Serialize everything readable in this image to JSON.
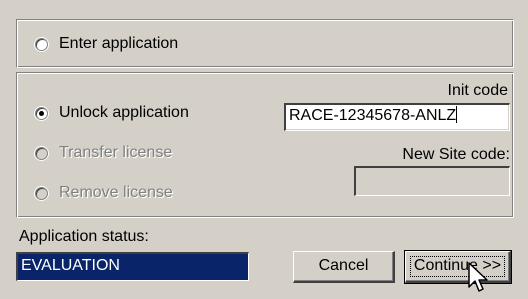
{
  "mode_options": {
    "enter": {
      "label": "Enter application",
      "selected": false
    },
    "unlock": {
      "label": "Unlock application",
      "selected": true
    },
    "transfer": {
      "label": "Transfer license",
      "selected": false,
      "enabled": false
    },
    "remove": {
      "label": "Remove license",
      "selected": false,
      "enabled": false
    }
  },
  "init_code": {
    "label": "Init code",
    "value": "RACE-12345678-ANLZ"
  },
  "new_site_code": {
    "label": "New Site code:",
    "value": ""
  },
  "status": {
    "label": "Application status:",
    "value": "EVALUATION"
  },
  "buttons": {
    "cancel": "Cancel",
    "continue": "Continue >>"
  },
  "icons": {
    "cursor": "arrow-pointer-icon"
  },
  "colors": {
    "status_bg": "#0a246a",
    "face": "#d4d0c8"
  }
}
